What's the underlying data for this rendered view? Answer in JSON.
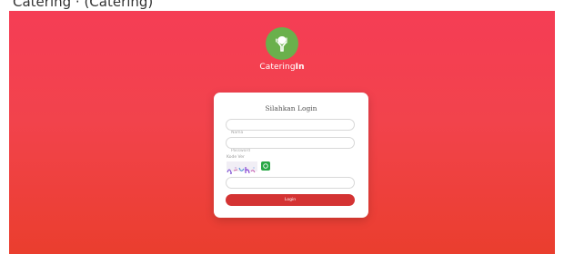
{
  "top_strip_text": "Catering · (Catering)",
  "brand": {
    "prefix": "Catering",
    "suffix": "In"
  },
  "form": {
    "title": "Silahkan Login",
    "username_placeholder": "Nama",
    "password_placeholder": "Password",
    "captcha_label": "Kode Ver",
    "captcha_placeholder": "",
    "login_label": "Login"
  },
  "colors": {
    "bg_top": "#f53d55",
    "bg_bottom": "#ea3e2e",
    "logo": "#6ab04c",
    "login_button": "#d43333",
    "refresh_button": "#28a745"
  },
  "icons": {
    "logo": "catering-logo-icon",
    "refresh": "refresh-icon"
  }
}
